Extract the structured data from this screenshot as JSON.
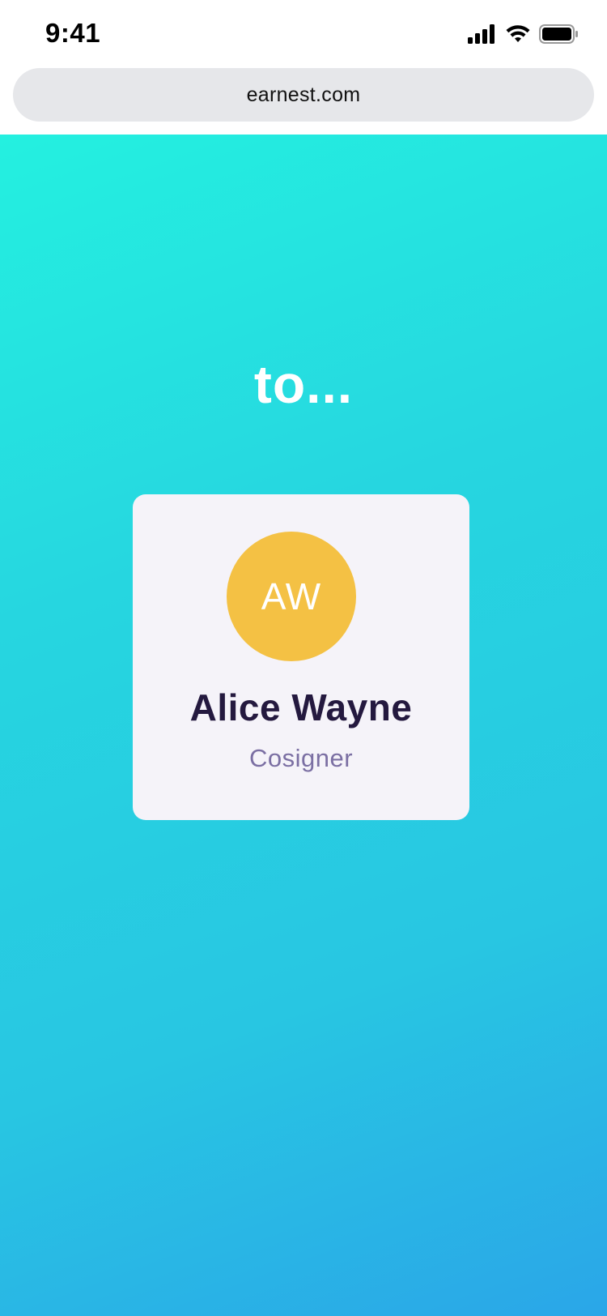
{
  "status_bar": {
    "time": "9:41",
    "icons": [
      "signal-icon",
      "wifi-icon",
      "battery-icon"
    ]
  },
  "browser": {
    "url": "earnest.com"
  },
  "main": {
    "headline": "to...",
    "card": {
      "avatar_initials": "AW",
      "name": "Alice Wayne",
      "role": "Cosigner"
    }
  },
  "colors": {
    "gradient_start": "#24f0e0",
    "gradient_end": "#2aa6e8",
    "avatar_bg": "#f4c144",
    "card_bg": "#f5f3f9",
    "name_text": "#24193f",
    "role_text": "#7b6fa3"
  }
}
